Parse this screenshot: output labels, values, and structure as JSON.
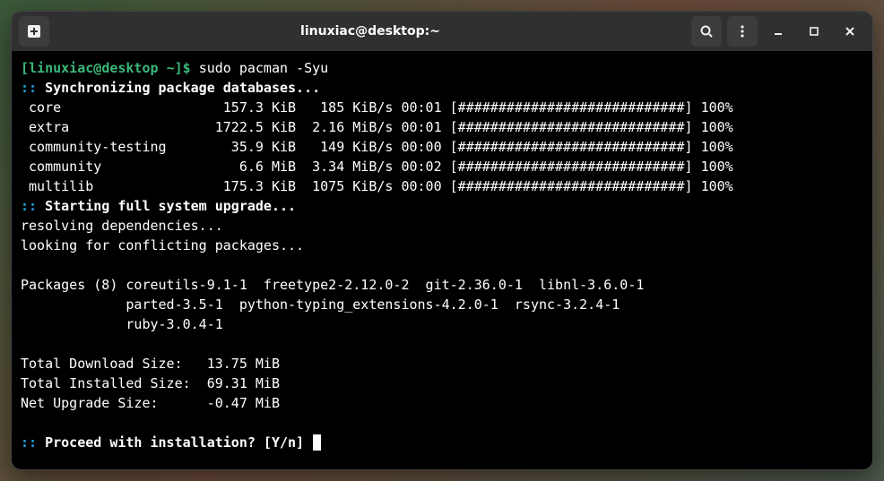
{
  "window": {
    "title": "linuxiac@desktop:~"
  },
  "prompt": {
    "user": "linuxiac",
    "host": "desktop",
    "path": "~",
    "separator_open": "[",
    "separator_close": "]",
    "symbol": "$"
  },
  "command": "sudo pacman -Syu",
  "sync_header": ":: Synchronizing package databases...",
  "repos": [
    {
      "name": "core",
      "size": "157.3 KiB",
      "rate": "185 KiB/s",
      "time": "00:01",
      "bar": "[############################]",
      "pct": "100%"
    },
    {
      "name": "extra",
      "size": "1722.5 KiB",
      "rate": "2.16 MiB/s",
      "time": "00:01",
      "bar": "[############################]",
      "pct": "100%"
    },
    {
      "name": "community-testing",
      "size": "35.9 KiB",
      "rate": "149 KiB/s",
      "time": "00:00",
      "bar": "[############################]",
      "pct": "100%"
    },
    {
      "name": "community",
      "size": "6.6 MiB",
      "rate": "3.34 MiB/s",
      "time": "00:02",
      "bar": "[############################]",
      "pct": "100%"
    },
    {
      "name": "multilib",
      "size": "175.3 KiB",
      "rate": "1075 KiB/s",
      "time": "00:00",
      "bar": "[############################]",
      "pct": "100%"
    }
  ],
  "upgrade_header": ":: Starting full system upgrade...",
  "resolving": "resolving dependencies...",
  "looking": "looking for conflicting packages...",
  "packages_label": "Packages (8)",
  "packages_line1": "coreutils-9.1-1  freetype2-2.12.0-2  git-2.36.0-1  libnl-3.6.0-1",
  "packages_line2": "parted-3.5-1  python-typing_extensions-4.2.0-1  rsync-3.2.4-1",
  "packages_line3": "ruby-3.0.4-1",
  "totals": {
    "download_label": "Total Download Size:   ",
    "download_value": "13.75 MiB",
    "installed_label": "Total Installed Size:  ",
    "installed_value": "69.31 MiB",
    "net_label": "Net Upgrade Size:      ",
    "net_value": "-0.47 MiB"
  },
  "proceed": ":: Proceed with installation? [Y/n]",
  "icons": {
    "new_tab": "new-tab-icon",
    "search": "search-icon",
    "menu": "menu-icon",
    "minimize": "minimize-icon",
    "maximize": "maximize-icon",
    "close": "close-icon"
  }
}
